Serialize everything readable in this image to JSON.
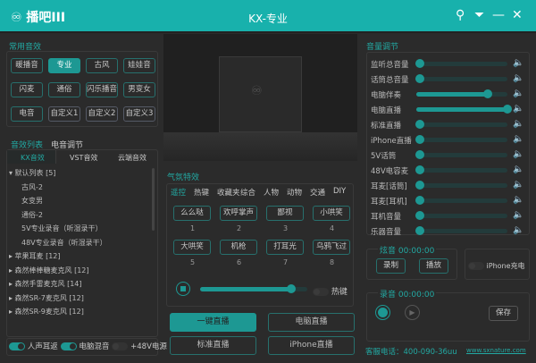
{
  "titlebar": {
    "logo": "♾ 播吧III",
    "title": "KX-专业",
    "pin": "⚲",
    "menu": "⏷",
    "min": "—",
    "close": "✕"
  },
  "common": {
    "label": "常用音效",
    "buttons": [
      "暖播音",
      "专业",
      "古风",
      "娃娃音",
      "闪麦",
      "通俗",
      "闪乐播音",
      "男变女",
      "电音",
      "自定义1",
      "自定义2",
      "自定义3"
    ],
    "active": 1
  },
  "list": {
    "tabs": [
      "音效列表",
      "电音调节"
    ],
    "subtabs": [
      "KX音效",
      "VST音效",
      "云端音效"
    ],
    "items": [
      {
        "t": "▾ 默认列表 [5]",
        "lv": 0
      },
      {
        "t": "古风-2",
        "lv": 1
      },
      {
        "t": "女变男",
        "lv": 1
      },
      {
        "t": "通俗-2",
        "lv": 1
      },
      {
        "t": "5V专业录音（听湿录干）",
        "lv": 1
      },
      {
        "t": "48V专业录音（听湿录干）",
        "lv": 1
      },
      {
        "t": "▸ 苹果耳麦 [12]",
        "lv": 0
      },
      {
        "t": "▸ 森然棒棒糖麦克风 [12]",
        "lv": 0
      },
      {
        "t": "▸ 森然手雷麦克风 [14]",
        "lv": 0
      },
      {
        "t": "▸ 森然SR-7麦克风 [12]",
        "lv": 0
      },
      {
        "t": "▸ 森然SR-9麦克风 [12]",
        "lv": 0
      }
    ]
  },
  "toggles": [
    {
      "label": "人声耳返",
      "on": true
    },
    {
      "label": "电脑混音",
      "on": true
    },
    {
      "label": "+48V电源",
      "on": false
    }
  ],
  "atmos": {
    "label": "气氛特效",
    "tabs": [
      "遥控",
      "热键",
      "收藏夹",
      "综合",
      "人物",
      "动物",
      "交通",
      "DIY"
    ],
    "buttons": [
      {
        "l": "么么哒",
        "n": "1"
      },
      {
        "l": "欢呼掌声",
        "n": "2"
      },
      {
        "l": "鄙视",
        "n": "3"
      },
      {
        "l": "小哄笑",
        "n": "4"
      },
      {
        "l": "大哄笑",
        "n": "5"
      },
      {
        "l": "机枪",
        "n": "6"
      },
      {
        "l": "打耳光",
        "n": "7"
      },
      {
        "l": "乌鸦飞过",
        "n": "8"
      }
    ],
    "volume": 0.85,
    "hotkey_label": "热键"
  },
  "live": [
    "一键直播",
    "电脑直播",
    "标准直播",
    "iPhone直播"
  ],
  "volume": {
    "label": "音量调节",
    "rows": [
      {
        "l": "监听总音量",
        "v": 0
      },
      {
        "l": "话筒总音量",
        "v": 0
      },
      {
        "l": "电脑伴奏",
        "v": 0.78
      },
      {
        "l": "电脑直播",
        "v": 1
      },
      {
        "l": "标准直播",
        "v": 0
      },
      {
        "l": "iPhone直播",
        "v": 0
      },
      {
        "l": "5V话筒",
        "v": 0
      },
      {
        "l": "48V电容麦",
        "v": 0
      },
      {
        "l": "耳麦[话筒]",
        "v": 0
      },
      {
        "l": "耳麦[耳机]",
        "v": 0
      },
      {
        "l": "耳机音量",
        "v": 0
      },
      {
        "l": "乐器音量",
        "v": 0
      }
    ]
  },
  "xuanyin": {
    "label": "炫音",
    "time": "00:00:00",
    "record": "录制",
    "play": "播放",
    "iphone_charge": "iPhone充电"
  },
  "luyin": {
    "label": "录音",
    "time": "00:00:00",
    "save": "保存"
  },
  "footer": {
    "phone": "客服电话：400-090-36uu",
    "url": "www.sxnature.com"
  }
}
